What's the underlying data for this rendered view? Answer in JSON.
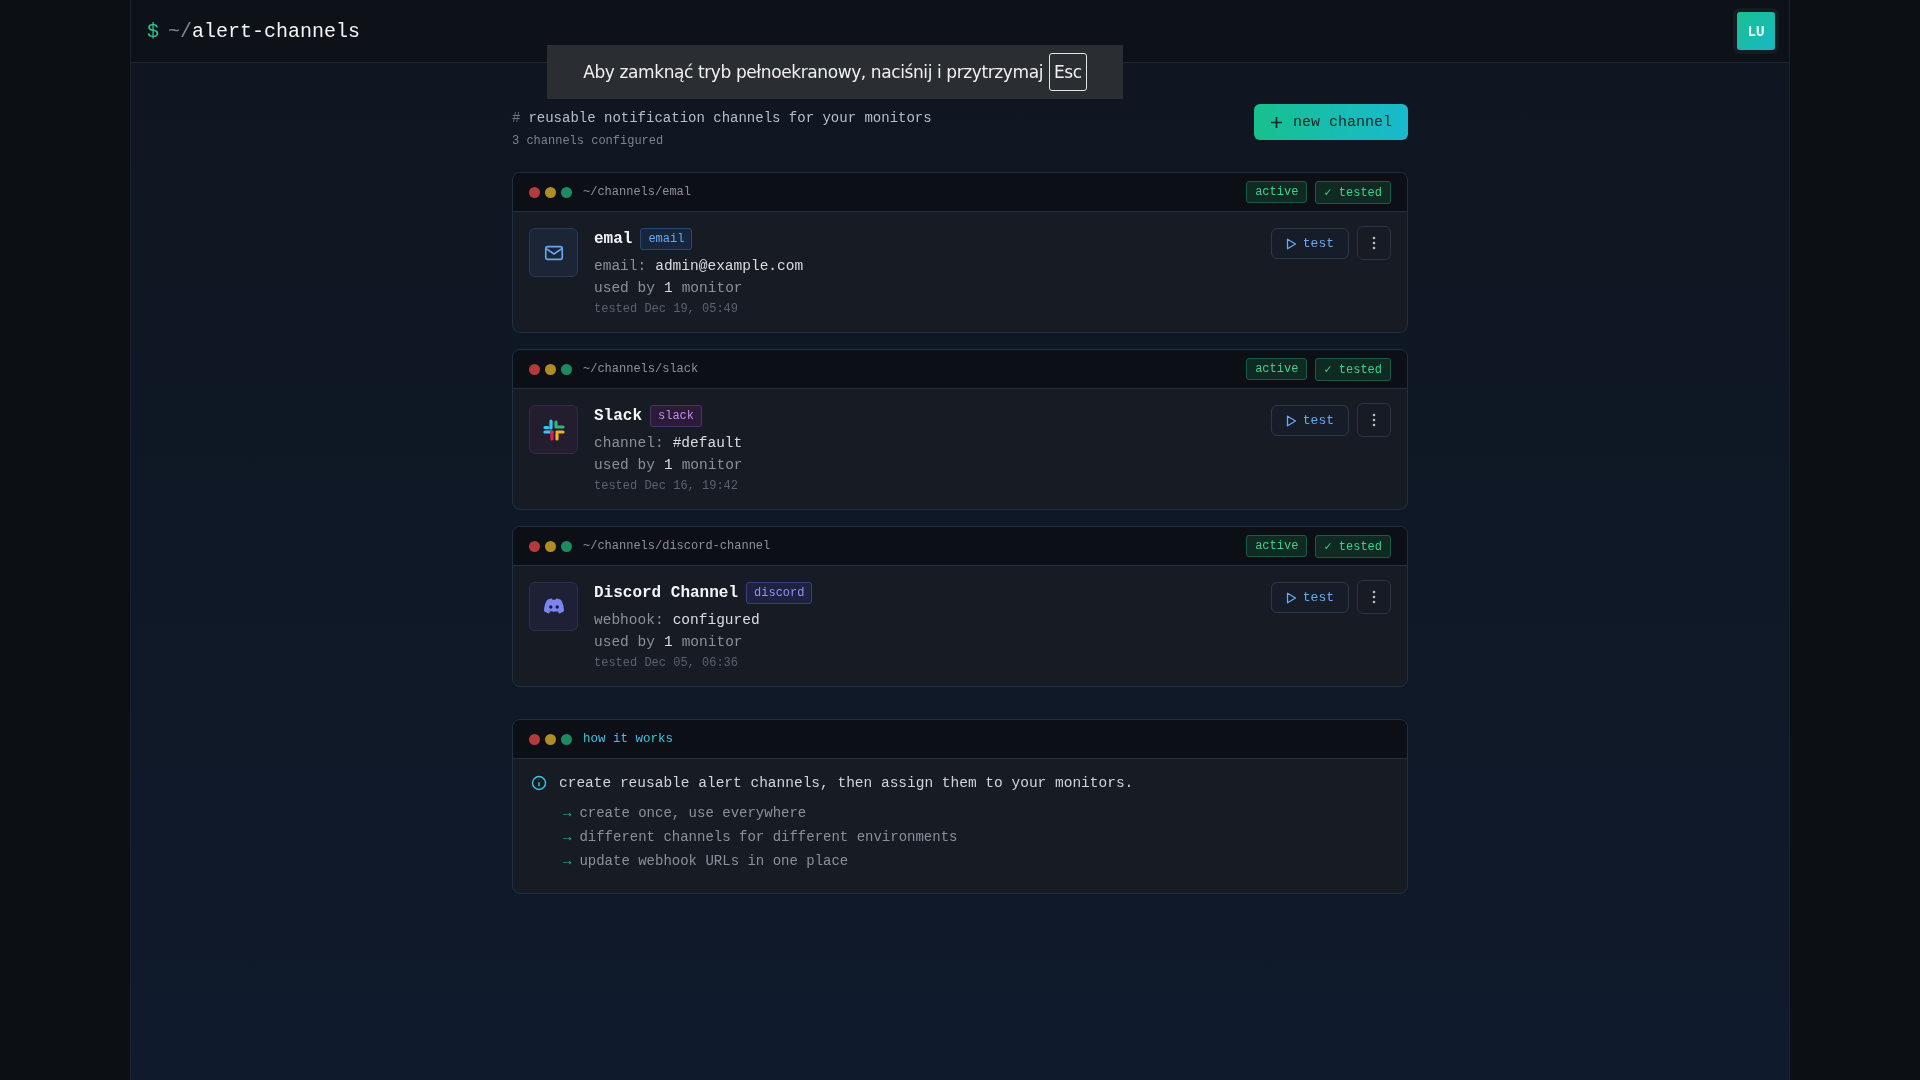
{
  "header": {
    "prompt": "$",
    "path_prefix": "~/",
    "title": "alert-channels",
    "avatar": "LU"
  },
  "fullscreen_notice": {
    "text": "Aby zamknąć tryb pełnoekranowy, naciśnij i przytrzymaj",
    "key": "Esc"
  },
  "page": {
    "marker": "#",
    "subtitle": "reusable notification channels for your monitors",
    "count": "3 channels configured",
    "new_button": "new channel"
  },
  "channels": [
    {
      "kind": "email",
      "path": "~/channels/emal",
      "badges": [
        "active",
        "✓ tested"
      ],
      "name": "emal",
      "tag": "email",
      "detail_label": "email:",
      "detail_value": "admin@example.com",
      "used_prefix": "used by",
      "used_count": "1",
      "used_suffix": "monitor",
      "tested": "tested Dec 19, 05:49",
      "test_button": "test"
    },
    {
      "kind": "slack",
      "path": "~/channels/slack",
      "badges": [
        "active",
        "✓ tested"
      ],
      "name": "Slack",
      "tag": "slack",
      "detail_label": "channel:",
      "detail_value": "#default",
      "used_prefix": "used by",
      "used_count": "1",
      "used_suffix": "monitor",
      "tested": "tested Dec 16, 19:42",
      "test_button": "test"
    },
    {
      "kind": "discord",
      "path": "~/channels/discord-channel",
      "badges": [
        "active",
        "✓ tested"
      ],
      "name": "Discord Channel",
      "tag": "discord",
      "detail_label": "webhook:",
      "detail_value": "configured",
      "used_prefix": "used by",
      "used_count": "1",
      "used_suffix": "monitor",
      "tested": "tested Dec 05, 06:36",
      "test_button": "test"
    }
  ],
  "info": {
    "title": "how it works",
    "lead": "create reusable alert channels, then assign them to your monitors.",
    "items": [
      {
        "arrow": "→",
        "text": "create once, use everywhere"
      },
      {
        "arrow": "→",
        "text": "different channels for different environments"
      },
      {
        "arrow": "→",
        "text": "update webhook URLs in one place"
      }
    ]
  }
}
